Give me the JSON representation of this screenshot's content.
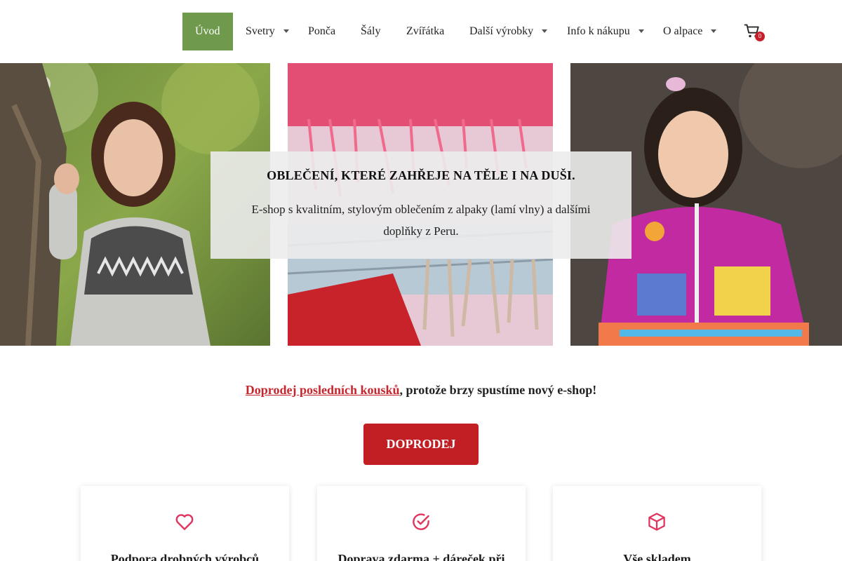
{
  "nav": {
    "items": [
      {
        "label": "Úvod"
      },
      {
        "label": "Svetry"
      },
      {
        "label": "Ponča"
      },
      {
        "label": "Šály"
      },
      {
        "label": "Zvířátka"
      },
      {
        "label": "Další výrobky"
      },
      {
        "label": "Info k nákupu"
      },
      {
        "label": "O alpace"
      }
    ],
    "cart_count": "0",
    "accent_color": "#6f9a4d"
  },
  "hero": {
    "title": "OBLEČENÍ, KTERÉ ZAHŘEJE NA TĚLE I NA DUŠI.",
    "subtitle": "E-shop s kvalitním, stylovým oblečením z alpaky (lamí vlny) a dalšími doplňky z Peru."
  },
  "promo": {
    "link_text": "Doprodej posledních kousků",
    "rest_text": ", protože brzy spustíme nový e-shop!",
    "button_label": "DOPRODEJ",
    "button_color": "#c11f24"
  },
  "features": [
    {
      "icon": "heart-icon",
      "title": "Podpora drobných výrobců"
    },
    {
      "icon": "check-circle-icon",
      "title": "Doprava zdarma + dáreček při"
    },
    {
      "icon": "box-icon",
      "title": "Vše skladem"
    }
  ]
}
